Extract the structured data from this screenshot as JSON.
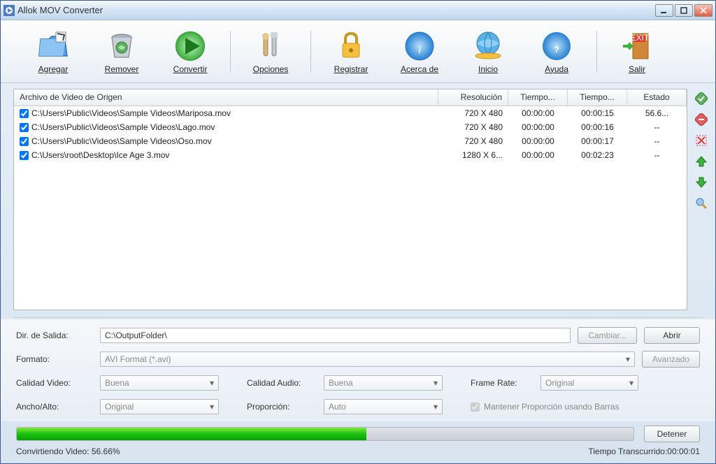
{
  "window": {
    "title": "Allok MOV Converter"
  },
  "toolbar": {
    "add": "Agregar",
    "remove": "Remover",
    "convert": "Convertir",
    "options": "Opciones",
    "register": "Registrar",
    "about": "Acerca de",
    "home": "Inicio",
    "help": "Ayuda",
    "exit": "Salir"
  },
  "table": {
    "headers": {
      "source": "Archivo de Video de Origen",
      "resolution": "Resolución",
      "time1": "Tiempo...",
      "time2": "Tiempo...",
      "status": "Estado"
    },
    "rows": [
      {
        "path": "C:\\Users\\Public\\Videos\\Sample Videos\\Mariposa.mov",
        "res": "720 X 480",
        "t1": "00:00:00",
        "t2": "00:00:15",
        "status": "56.6..."
      },
      {
        "path": "C:\\Users\\Public\\Videos\\Sample Videos\\Lago.mov",
        "res": "720 X 480",
        "t1": "00:00:00",
        "t2": "00:00:16",
        "status": "--"
      },
      {
        "path": "C:\\Users\\Public\\Videos\\Sample Videos\\Oso.mov",
        "res": "720 X 480",
        "t1": "00:00:00",
        "t2": "00:00:17",
        "status": "--"
      },
      {
        "path": "C:\\Users\\root\\Desktop\\Ice Age 3.mov",
        "res": "1280 X 6...",
        "t1": "00:00:00",
        "t2": "00:02:23",
        "status": "--"
      }
    ]
  },
  "settings": {
    "outdir_label": "Dir. de Salida:",
    "outdir_value": "C:\\OutputFolder\\",
    "change": "Cambiar...",
    "open": "Abrir",
    "format_label": "Formato:",
    "format_value": "AVI Format (*.avi)",
    "advanced": "Avanzado",
    "vq_label": "Calidad Video:",
    "vq_value": "Buena",
    "aq_label": "Calidad Audio:",
    "aq_value": "Buena",
    "fr_label": "Frame Rate:",
    "fr_value": "Original",
    "wh_label": "Ancho/Alto:",
    "wh_value": "Original",
    "prop_label": "Proporción:",
    "prop_value": "Auto",
    "keepbars": "Mantener Proporción usando Barras"
  },
  "progress": {
    "stop": "Detener",
    "status_left": "Convirtiendo Video: 56.66%",
    "status_right": "Tiempo Transcurrido:00:00:01",
    "percent": 56.66
  }
}
